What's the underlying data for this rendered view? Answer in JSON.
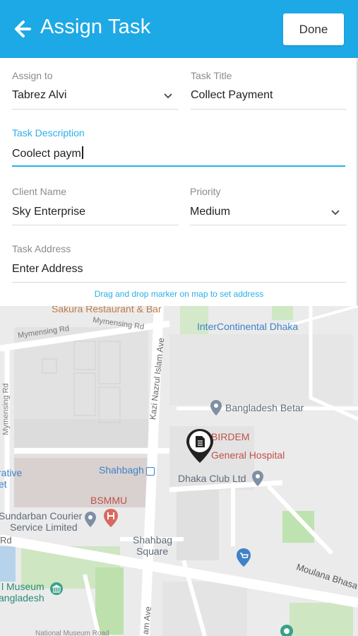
{
  "header": {
    "title": "Assign Task",
    "done_label": "Done",
    "color": "#1ca9e6"
  },
  "form": {
    "assign_to": {
      "label": "Assign to",
      "value": "Tabrez Alvi"
    },
    "task_title": {
      "label": "Task Title",
      "value": "Collect Payment"
    },
    "task_description": {
      "label": "Task Description",
      "value": "Coolect paym"
    },
    "client_name": {
      "label": "Client Name",
      "value": "Sky Enterprise"
    },
    "priority": {
      "label": "Priority",
      "value": "Medium"
    },
    "task_address": {
      "label": "Task Address",
      "value": "Enter Address"
    },
    "hint": "Drag and drop marker on map to set address",
    "accent_color": "#2ab0e8"
  },
  "map": {
    "labels": {
      "sakura": "Sakura Restaurant & Bar",
      "intercontinental": "InterContinental Dhaka",
      "mymensing_rd_1": "Mymensing Rd",
      "mymensing_rd_2": "Mymensing Rd",
      "mymensing_rd_3": "Mymensing Rd",
      "kazi_nazrul": "Kazi Nazrul Islam Ave",
      "bangladesh_betar": "Bangladesh Betar",
      "birdem_1": "BIRDEM",
      "birdem_2": "General Hospital",
      "rative": "rative",
      "et": "et",
      "shahbagh": "Shahbagh",
      "dhaka_club": "Dhaka Club Ltd",
      "bsmmu": "BSMMU",
      "sundarban_1": "Sundarban Courier",
      "sundarban_2": "Service Limited",
      "shahbag_sq_1": "Shahbag",
      "shahbag_sq_2": "Square",
      "rd": "Rd",
      "moulana": "Moulana Bhasa",
      "museum_1": "l Museum",
      "museum_2": "angladesh",
      "am_ave": "am Ave",
      "national_museum": "National Museum Road"
    }
  }
}
